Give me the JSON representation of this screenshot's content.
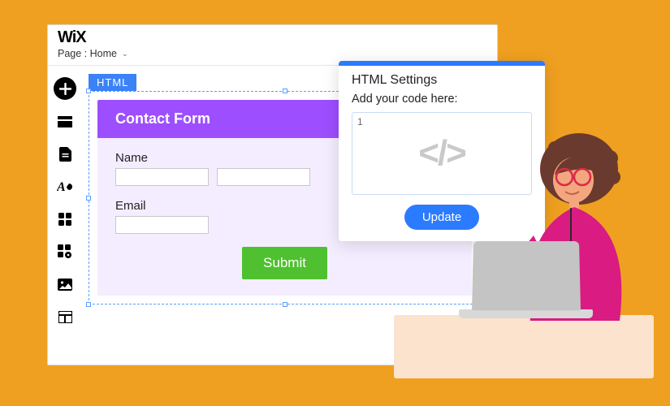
{
  "header": {
    "logo": "WiX",
    "page_label": "Page : Home"
  },
  "canvas": {
    "element_tag": "HTML",
    "contact_form": {
      "title": "Contact Form",
      "name_label": "Name",
      "email_label": "Email",
      "submit_label": "Submit"
    }
  },
  "popup": {
    "title": "HTML Settings",
    "subtitle": "Add your code here:",
    "line_number": "1",
    "code_placeholder_glyph": "</>",
    "update_label": "Update"
  },
  "sidebar": {
    "items": [
      {
        "name": "add"
      },
      {
        "name": "section"
      },
      {
        "name": "page"
      },
      {
        "name": "text-style"
      },
      {
        "name": "apps"
      },
      {
        "name": "app-settings"
      },
      {
        "name": "media"
      },
      {
        "name": "layout"
      }
    ]
  }
}
